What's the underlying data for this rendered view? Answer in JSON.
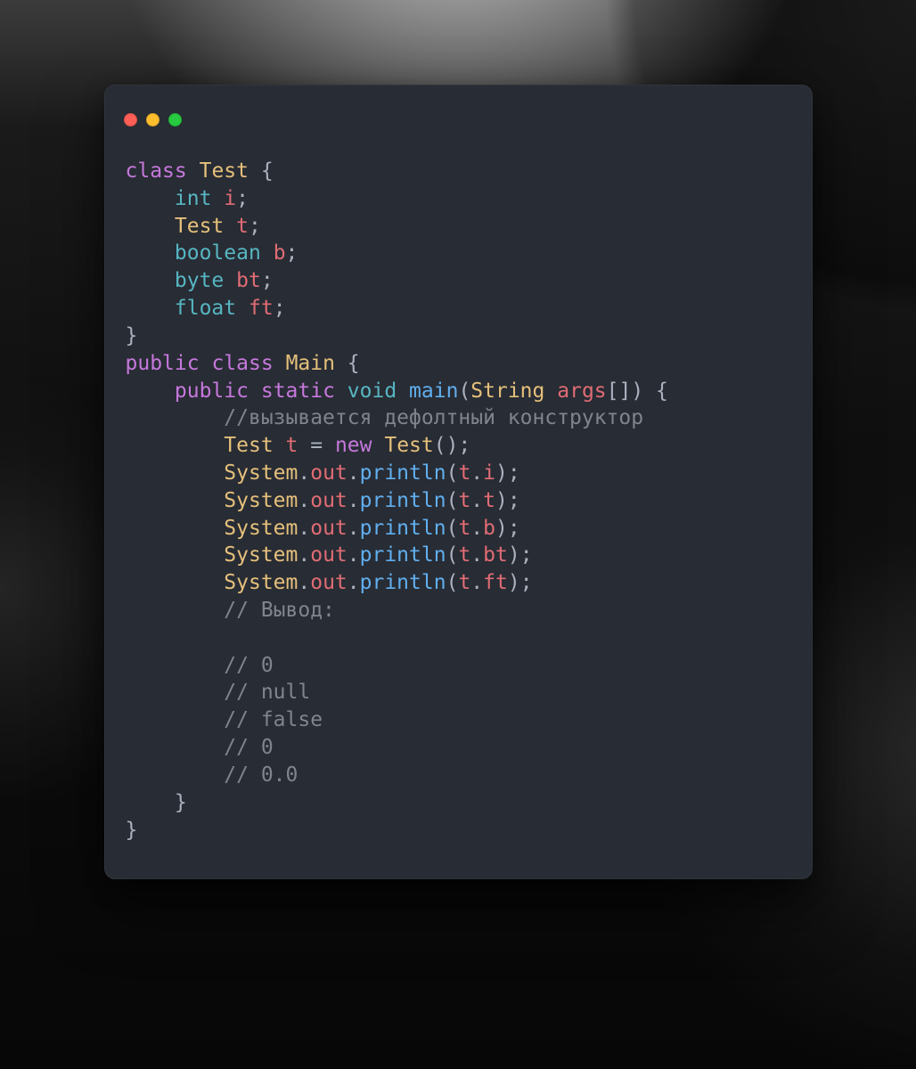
{
  "colors": {
    "window_bg": "#282c34",
    "dot_red": "#ff5f56",
    "dot_yellow": "#ffbd2e",
    "dot_green": "#27c93f",
    "keyword": "#c678dd",
    "type": "#56b6c2",
    "class_name": "#e5c07b",
    "function": "#61afef",
    "variable": "#e06c75",
    "plain": "#abb2bf",
    "comment": "#7f848e"
  },
  "code": {
    "kw_class1": "class",
    "cls_test1": "Test",
    "brace_open1": " {",
    "indent1": "    ",
    "type_int": "int",
    "var_i": "i",
    "semi": ";",
    "cls_test2": "Test",
    "var_t_field": "t",
    "type_boolean": "boolean",
    "var_b": "b",
    "type_byte": "byte",
    "var_bt": "bt",
    "type_float": "float",
    "var_ft": "ft",
    "brace_close1": "}",
    "kw_public1": "public",
    "kw_class2": "class",
    "cls_main": "Main",
    "brace_open2": " {",
    "indent2": "    ",
    "kw_public2": "public",
    "kw_static": "static",
    "type_void": "void",
    "fn_main": "main",
    "paren_open": "(",
    "cls_string": "String",
    "param_args": "args",
    "brackets": "[]",
    "paren_close": ")",
    "brace_open3": " {",
    "indent3": "        ",
    "comment_ctor": "//вызывается дефолтный конструктор",
    "cls_test3": "Test",
    "var_t_local": "t",
    "equals": " = ",
    "kw_new": "new",
    "cls_test4": "Test",
    "call_parens": "();",
    "sys": "System",
    "dot": ".",
    "out": "out",
    "println": "println",
    "arg_open": "(",
    "var_t_ref": "t",
    "field_i": "i",
    "field_t": "t",
    "field_b": "b",
    "field_bt": "bt",
    "field_ft": "ft",
    "arg_close": ");",
    "comment_output": "// Вывод:",
    "comment_blank": "",
    "comment_0a": "// 0",
    "comment_null": "// null",
    "comment_false": "// false",
    "comment_0b": "// 0",
    "comment_00": "// 0.0",
    "brace_close2": "}",
    "brace_close3": "}"
  }
}
